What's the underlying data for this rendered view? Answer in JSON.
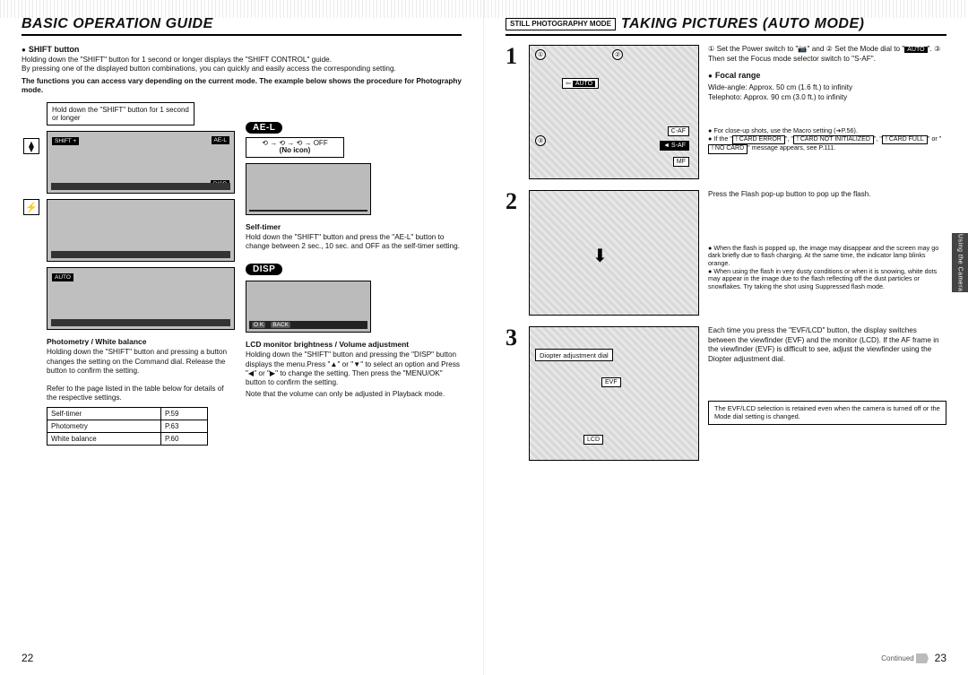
{
  "left_page": {
    "title": "BASIC OPERATION GUIDE",
    "shift_heading": "SHIFT button",
    "shift_p1": "Holding down the \"SHIFT\" button for 1 second or longer displays the \"SHIFT CONTROL\" guide.",
    "shift_p2": "By pressing one of the displayed button combinations, you can quickly and easily access the corresponding setting.",
    "shift_p3": "The functions you can access vary depending on the current mode. The example below shows the procedure for Photography mode.",
    "hold_box": "Hold down the \"SHIFT\" button for 1 second or longer",
    "ael_pill": "AE-L",
    "noicon_line1": "⟲ → ⟲ → ⟲ → OFF",
    "noicon_line2": "(No icon)",
    "selftimer_h": "Self-timer",
    "selftimer_p": "Hold down the \"SHIFT\" button and press the \"AE-L\" button to change between 2 sec., 10 sec. and OFF as the self-timer setting.",
    "disp_pill": "DISP",
    "lcd_h": "LCD monitor brightness / Volume adjustment",
    "lcd_p1": "Holding down the \"SHIFT\" button and pressing the \"DISP\" button displays the menu.Press \"▲\" or \"▼\" to select an option and Press \"◀\" or \"▶\" to change the setting. Then press the \"MENU/OK\" button to confirm the setting.",
    "lcd_p2": "Note that the volume can only be adjusted in Playback mode.",
    "photometry_h": "Photometry / White balance",
    "photometry_p": "Holding down the \"SHIFT\" button and pressing a button changes the setting on the Command dial. Release the button to confirm the setting.",
    "refer_text": "Refer to the page listed in the table below for details of the respective settings.",
    "table": [
      {
        "label": "Self-timer",
        "page": "P.59"
      },
      {
        "label": "Photometry",
        "page": "P.63"
      },
      {
        "label": "White balance",
        "page": "P.60"
      }
    ],
    "mini_ok": "O K",
    "mini_back": "BACK",
    "page_number": "22"
  },
  "right_page": {
    "mode_box": "STILL PHOTOGRAPHY MODE",
    "title": "TAKING PICTURES (AUTO MODE)",
    "step1_text_a": "① Set the Power switch to \"📷\" and ② Set the Mode dial to \"",
    "step1_auto": "AUTO",
    "step1_text_b": "\". ③ Then set the Focus mode selector switch to \"S-AF\".",
    "focal_h": "Focal range",
    "focal_wide": "Wide-angle: Approx. 50 cm (1.6 ft.) to infinity",
    "focal_tele": "Telephoto: Approx. 90 cm (3.0 ft.) to infinity",
    "step1_note1": "For close-up shots, use the Macro setting (➔P.56).",
    "step1_note2_a": "If the \"",
    "step1_note2_b": "! CARD ERROR",
    "step1_note2_c": "\", \"",
    "step1_note2_d": "! CARD NOT INITIALIZED",
    "step1_note2_e": "\", \"",
    "step1_note2_f": "! CARD FULL",
    "step1_note2_g": "\" or \"",
    "step1_note2_h": "! NO CARD",
    "step1_note2_i": "\" message appears, see P.111.",
    "illus1_caf": "C-AF",
    "illus1_saf": "S-AF",
    "illus1_mf": "MF",
    "illus1_auto": "AUTO",
    "step2_text": "Press the Flash pop-up button to pop up the flash.",
    "step2_note1": "When the flash is popped up, the image may disappear and the screen may go dark briefly due to flash charging. At the same time, the indicator lamp blinks orange.",
    "step2_note2": "When using the flash in very dusty conditions or when it is snowing, white dots may appear in the image due to the flash reflecting off the dust particles or snowflakes. Try taking the shot using Suppressed flash mode.",
    "step3_text": "Each time you press the \"EVF/LCD\" button, the display switches between the viewfinder (EVF) and the monitor (LCD). If the AF frame in the viewfinder (EVF) is difficult to see, adjust the viewfinder using the Diopter adjustment dial.",
    "step3_diopter": "Diopter adjustment dial",
    "step3_evf": "EVF",
    "step3_lcd": "LCD",
    "step3_box": "The EVF/LCD selection is retained even when the camera is turned off or the Mode dial setting is changed.",
    "thumb_tab": "Using the Camera",
    "continued": "Continued",
    "page_number": "23"
  }
}
